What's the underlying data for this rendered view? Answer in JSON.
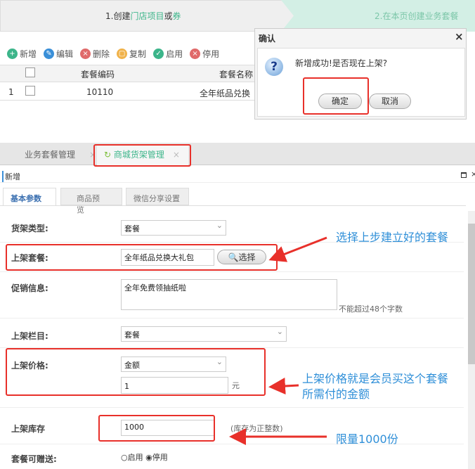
{
  "steps": {
    "step1_prefix": "1.创建",
    "step1_link1": "门店项目",
    "step1_mid": "或",
    "step1_link2": "券",
    "step2": "2.在本页创建业务套餐"
  },
  "toolbar": [
    {
      "label": "新增",
      "color": "#3cb58a",
      "icon": "plus-icon"
    },
    {
      "label": "编辑",
      "color": "#3a8fd8",
      "icon": "pencil-icon"
    },
    {
      "label": "删除",
      "color": "#e06a6a",
      "icon": "delete-icon"
    },
    {
      "label": "复制",
      "color": "#f0b24a",
      "icon": "copy-icon"
    },
    {
      "label": "启用",
      "color": "#3cb58a",
      "icon": "check-icon"
    },
    {
      "label": "停用",
      "color": "#e06a6a",
      "icon": "stop-icon"
    }
  ],
  "table": {
    "headers": [
      "套餐编码",
      "套餐名称"
    ],
    "rows": [
      {
        "index": "1",
        "code": "10110",
        "name": "全年纸品兑换"
      }
    ]
  },
  "dialog": {
    "title": "确认",
    "close": "×",
    "message": "新增成功!是否现在上架?",
    "ok": "确定",
    "cancel": "取消"
  },
  "tabs": [
    {
      "label": "业务套餐管理",
      "close": "×"
    },
    {
      "label": "商城货架管理",
      "close": "×"
    }
  ],
  "panel": {
    "title": "新增",
    "subtabs": [
      "基本参数",
      "商品预览",
      "微信分享设置"
    ]
  },
  "form": {
    "shelf_type": {
      "label": "货架类型:",
      "value": "套餐"
    },
    "package": {
      "label": "上架套餐:",
      "value": "全年纸品兑换大礼包",
      "button": "选择"
    },
    "promo": {
      "label": "促销信息:",
      "value": "全年免费领抽纸啦",
      "hint": "不能超过48个字数"
    },
    "column": {
      "label": "上架栏目:",
      "value": "套餐"
    },
    "price": {
      "label": "上架价格:",
      "type": "金额",
      "value": "1",
      "unit": "元"
    },
    "stock": {
      "label": "上架库存",
      "value": "1000",
      "hint": "(库存为正整数)"
    },
    "giftable": {
      "label": "套餐可赠送:",
      "opt1": "启用",
      "opt2": "停用",
      "selected": "停用"
    }
  },
  "annotations": {
    "a1": "选择上步建立好的套餐",
    "a2_l1": "上架价格就是会员买这个套餐",
    "a2_l2": "所需付的金额",
    "a3": "限量1000份"
  }
}
